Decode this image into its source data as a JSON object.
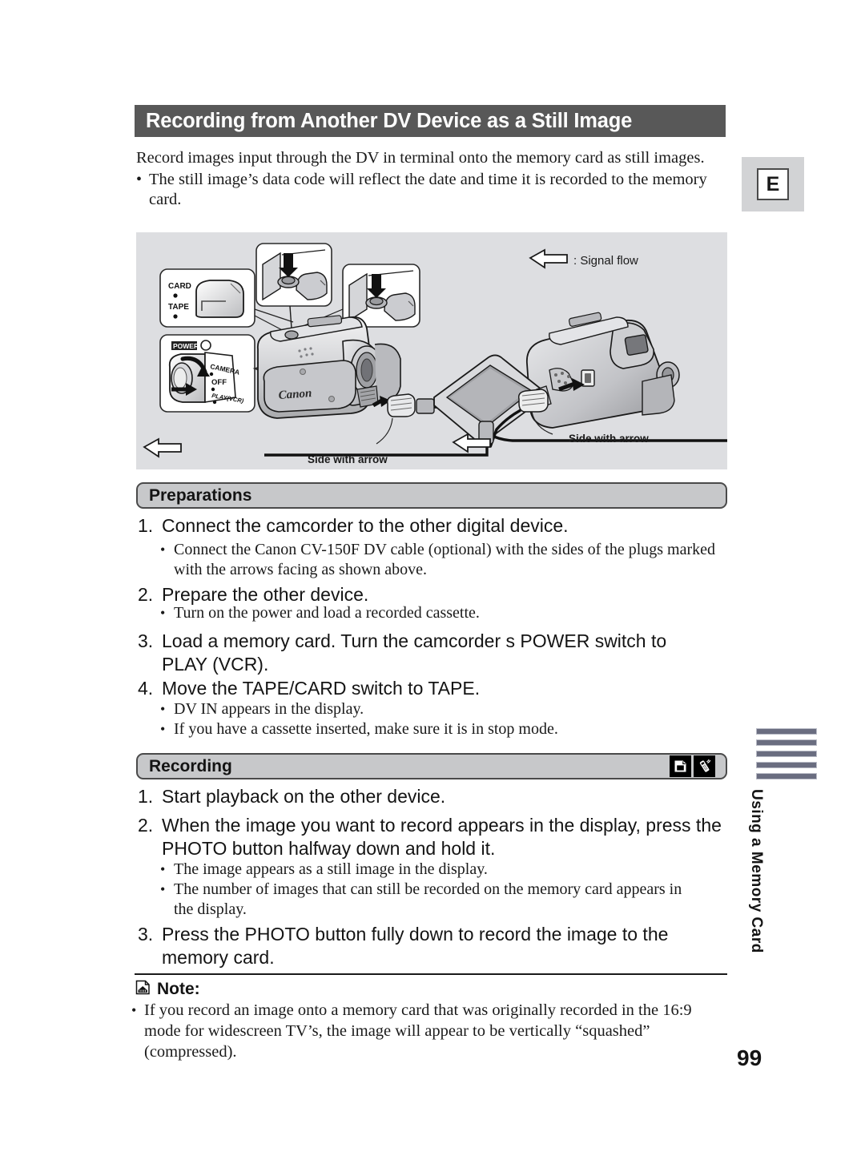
{
  "page": {
    "title": "Recording from Another DV Device as a Still Image",
    "language_tab": "E",
    "page_number": "99",
    "side_tab_label": "Using a Memory Card",
    "side_tab_bar_count": 5
  },
  "intro": {
    "paragraph": "Record images input through the DV in terminal onto the memory card as still images.",
    "bullets": [
      "The still image’s data code will reflect the date and time it is recorded to the memory card."
    ]
  },
  "figure": {
    "signal_flow_label": ": Signal flow",
    "side_with_arrow_left": "Side with arrow",
    "side_with_arrow_right": "Side with arrow",
    "switch_card_label": "CARD",
    "switch_tape_label": "TAPE",
    "power_label": "POWER",
    "power_camera": "CAMERA",
    "power_off": "OFF",
    "power_playvcr": "PLAY(VCR)",
    "brand": "Canon",
    "background_color": "#dddee1"
  },
  "preparations": {
    "heading": "Preparations",
    "steps": [
      {
        "num": "1.",
        "text": "Connect the camcorder to the other digital device.",
        "bullets": [
          "Connect the Canon CV-150F DV cable (optional) with the sides of the plugs marked with the arrows facing as shown above."
        ]
      },
      {
        "num": "2.",
        "text": "Prepare the other device.",
        "bullets": [
          "Turn on the power and load a recorded cassette."
        ]
      },
      {
        "num": "3.",
        "text": "Load a memory card. Turn the camcorder s POWER switch to PLAY (VCR).",
        "bullets": []
      },
      {
        "num": "4.",
        "text": "Move the TAPE/CARD switch to TAPE.",
        "bullets": [
          "DV IN appears in the display.",
          "If you have a cassette inserted, make sure it is in stop mode."
        ]
      }
    ]
  },
  "recording": {
    "heading": "Recording",
    "icons": [
      "memory-card-icon",
      "wireless-remote-icon"
    ],
    "steps": [
      {
        "num": "1.",
        "text": "Start playback on the other device.",
        "bullets": []
      },
      {
        "num": "2.",
        "text": "When the image you want to record appears in the display, press the PHOTO button halfway down and hold it.",
        "bullets": [
          "The image appears as a still image in the display.",
          "The number of images that can still be recorded on the memory card appears in the display."
        ]
      },
      {
        "num": "3.",
        "text": "Press the PHOTO button fully down to record the image to the memory card.",
        "bullets": []
      }
    ]
  },
  "note": {
    "label": "Note:",
    "icon": "memory-card-icon",
    "bullets": [
      "If you record an image onto a memory card that was originally recorded in the 16:9 mode for widescreen TV’s, the image will appear to be vertically “squashed” (compressed)."
    ]
  },
  "colors": {
    "title_bar": "#585858",
    "section_pill": "#c7c8ca",
    "figure_bg": "#dddee1",
    "side_bar": "#6a6d80"
  }
}
